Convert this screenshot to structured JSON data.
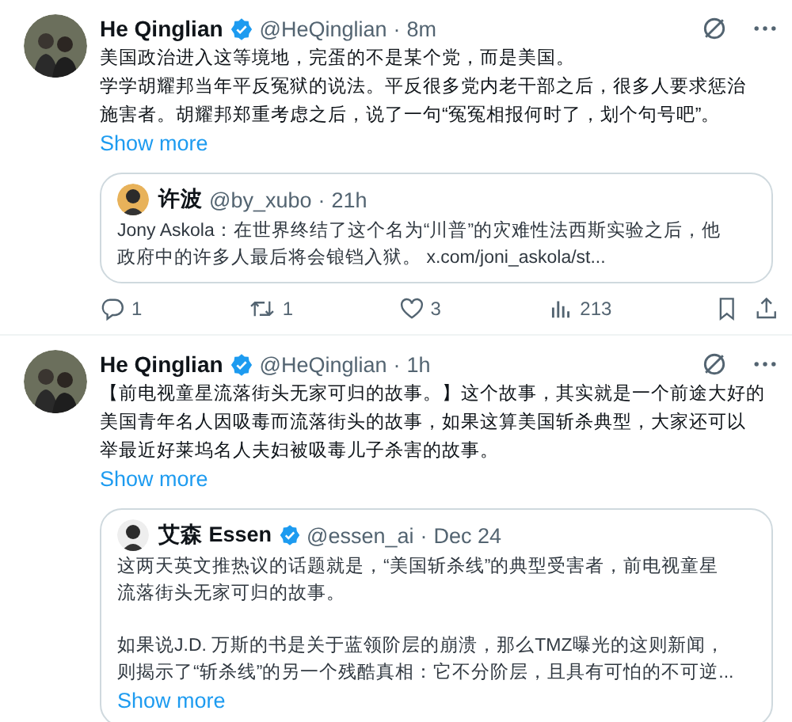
{
  "posts": [
    {
      "author": "He Qinglian",
      "verified": true,
      "handle": "@HeQinglian",
      "separator": "·",
      "time": "8m",
      "lines": [
        "美国政治进入这等境地，完蛋的不是某个党，而是美国。",
        "学学胡耀邦当年平反冤狱的说法。平反很多党内老干部之后，很多人要求惩治",
        "施害者。胡耀邦郑重考虑之后，说了一句“冤冤相报何时了，划个句号吧”。"
      ],
      "show_more": "Show more",
      "quote": {
        "author": "许波",
        "verified": false,
        "handle": "@by_xubo",
        "separator": "·",
        "time": "21h",
        "paragraphs": [
          [
            "Jony Askola：在世界终结了这个名为“川普”的灾难性法西斯实验之后，他",
            "政府中的许多人最后将会锒铛入狱。 x.com/joni_askola/st..."
          ]
        ]
      },
      "actions": {
        "replies": "1",
        "reposts": "1",
        "likes": "3",
        "views": "213"
      }
    },
    {
      "author": "He Qinglian",
      "verified": true,
      "handle": "@HeQinglian",
      "separator": "·",
      "time": "1h",
      "lines": [
        "【前电视童星流落街头无家可归的故事。】这个故事，其实就是一个前途大好的",
        "美国青年名人因吸毒而流落街头的故事，如果这算美国斩杀典型，大家还可以",
        "举最近好莱坞名人夫妇被吸毒儿子杀害的故事。"
      ],
      "show_more": "Show more",
      "quote": {
        "author": "艾森 Essen",
        "verified": true,
        "handle": "@essen_ai",
        "separator": "·",
        "time": "Dec 24",
        "paragraphs": [
          [
            "这两天英文推热议的话题就是，“美国斩杀线”的典型受害者，前电视童星",
            "流落街头无家可归的故事。"
          ],
          [
            "如果说J.D. 万斯的书是关于蓝领阶层的崩溃，那么TMZ曝光的这则新闻，",
            "则揭示了“斩杀线”的另一个残酷真相：它不分阶层，且具有可怕的不可逆..."
          ]
        ],
        "show_more": "Show more"
      }
    }
  ]
}
